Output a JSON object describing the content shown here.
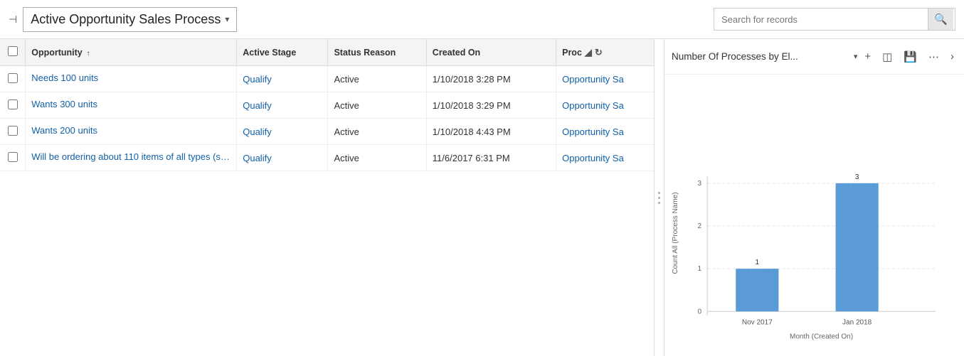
{
  "header": {
    "title": "Active Opportunity Sales Process",
    "title_chevron": "▾",
    "pin_icon": "📌",
    "search_placeholder": "Search for records",
    "search_icon": "🔍"
  },
  "table": {
    "columns": [
      {
        "id": "checkbox",
        "label": ""
      },
      {
        "id": "opportunity",
        "label": "Opportunity",
        "sort": "↑"
      },
      {
        "id": "active_stage",
        "label": "Active Stage"
      },
      {
        "id": "status_reason",
        "label": "Status Reason"
      },
      {
        "id": "created_on",
        "label": "Created On"
      },
      {
        "id": "process",
        "label": "Proc"
      }
    ],
    "rows": [
      {
        "opportunity": "Needs 100 units",
        "active_stage": "Qualify",
        "status_reason": "Active",
        "created_on": "1/10/2018 3:28 PM",
        "process": "Opportunity Sa"
      },
      {
        "opportunity": "Wants 300 units",
        "active_stage": "Qualify",
        "status_reason": "Active",
        "created_on": "1/10/2018 3:29 PM",
        "process": "Opportunity Sa"
      },
      {
        "opportunity": "Wants 200 units",
        "active_stage": "Qualify",
        "status_reason": "Active",
        "created_on": "1/10/2018 4:43 PM",
        "process": "Opportunity Sa"
      },
      {
        "opportunity": "Will be ordering about 110 items of all types (sa...",
        "active_stage": "Qualify",
        "status_reason": "Active",
        "created_on": "11/6/2017 6:31 PM",
        "process": "Opportunity Sa"
      }
    ]
  },
  "chart": {
    "title": "Number Of Processes by El...",
    "chevron": "▾",
    "toolbar": {
      "add_label": "+",
      "layout_label": "⊞",
      "save_label": "💾",
      "more_label": "···",
      "expand_label": "›"
    },
    "y_axis_label": "Count All (Process Name)",
    "x_axis_label": "Month (Created On)",
    "bars": [
      {
        "label": "Nov 2017",
        "value": 1,
        "color": "#5b9bd5"
      },
      {
        "label": "Jan 2018",
        "value": 3,
        "color": "#5b9bd5"
      }
    ],
    "y_max": 3,
    "y_ticks": [
      0,
      1,
      2,
      3
    ]
  }
}
